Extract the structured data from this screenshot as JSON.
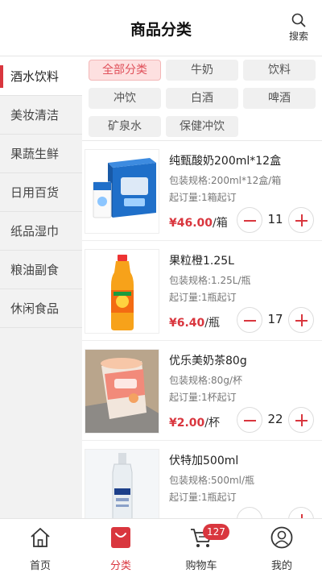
{
  "header": {
    "title": "商品分类",
    "search_label": "搜索"
  },
  "sidebar": {
    "items": [
      {
        "label": "酒水饮料"
      },
      {
        "label": "美妆清洁"
      },
      {
        "label": "果蔬生鲜"
      },
      {
        "label": "日用百货"
      },
      {
        "label": "纸品湿巾"
      },
      {
        "label": "粮油副食"
      },
      {
        "label": "休闲食品"
      }
    ],
    "active": "酒水饮料"
  },
  "subcategories": [
    {
      "label": "全部分类"
    },
    {
      "label": "牛奶"
    },
    {
      "label": "饮料"
    },
    {
      "label": "冲饮"
    },
    {
      "label": "白酒"
    },
    {
      "label": "啤酒"
    },
    {
      "label": "矿泉水"
    },
    {
      "label": "保健冲饮"
    }
  ],
  "products": [
    {
      "name": "纯甄酸奶200ml*12盒",
      "spec": "包装规格:200ml*12盒/箱",
      "min_order": "起订量:1箱起订",
      "price": "¥46.00",
      "unit": "/箱",
      "qty": "11"
    },
    {
      "name": "果粒橙1.25L",
      "spec": "包装规格:1.25L/瓶",
      "min_order": "起订量:1瓶起订",
      "price": "¥6.40",
      "unit": "/瓶",
      "qty": "17"
    },
    {
      "name": "优乐美奶茶80g",
      "spec": "包装规格:80g/杯",
      "min_order": "起订量:1杯起订",
      "price": "¥2.00",
      "unit": "/杯",
      "qty": "22"
    },
    {
      "name": "伏特加500ml",
      "spec": "包装规格:500ml/瓶",
      "min_order": "起订量:1瓶起订",
      "price": "",
      "unit": "",
      "qty": ""
    }
  ],
  "tabbar": {
    "home": "首页",
    "category": "分类",
    "cart": "购物车",
    "cart_badge": "127",
    "mine": "我的"
  },
  "colors": {
    "accent": "#d9363e",
    "chip_active_bg": "#fde0e0",
    "sidebar_bg": "#f2f2f2"
  }
}
